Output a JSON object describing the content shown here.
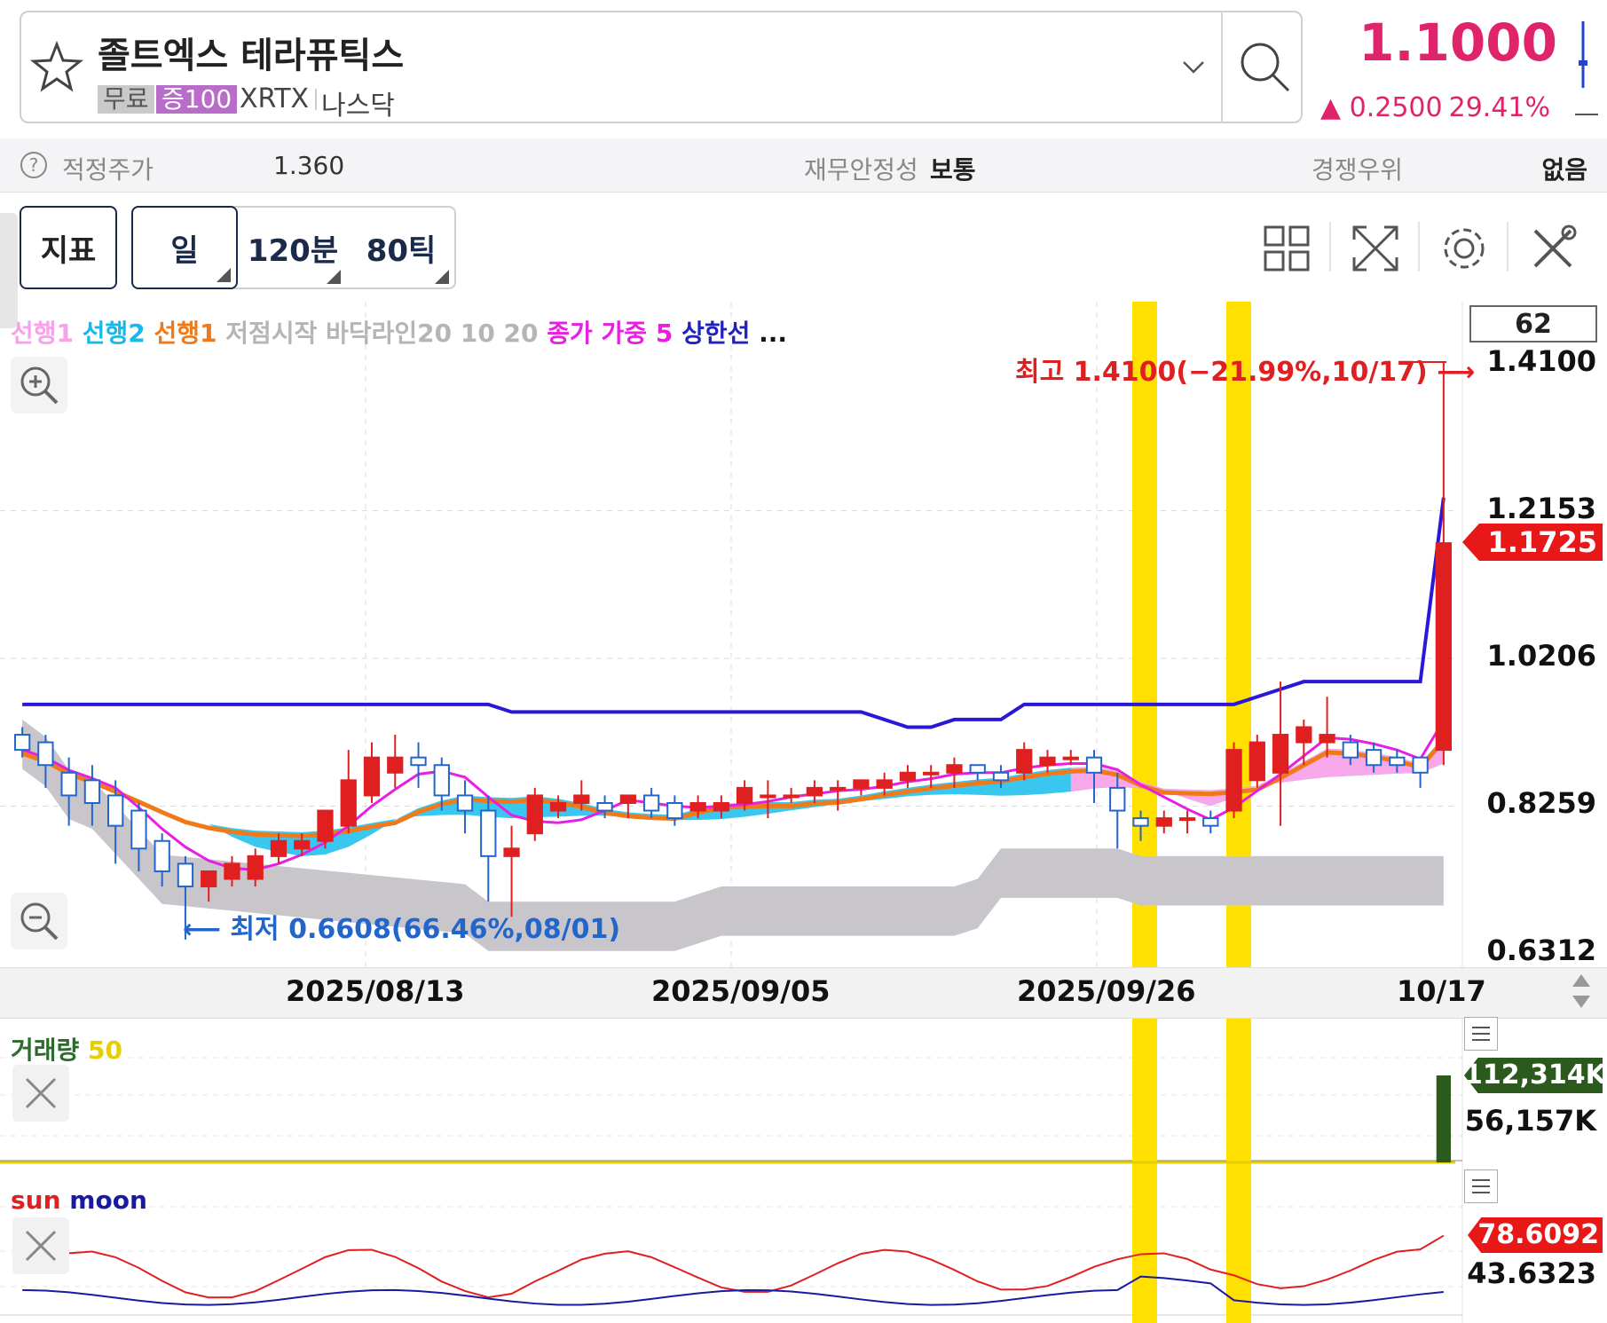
{
  "header": {
    "stock_name": "졸트엑스 테라퓨틱스",
    "tag_free": "무료",
    "tag_margin": "증100",
    "ticker": "XRTX",
    "exchange": "나스닥",
    "price": "1.1000",
    "change": "▲ 0.2500",
    "change_pct": "29.41%",
    "price_color": "#e0246b"
  },
  "info": {
    "fair_price_label": "적정주가",
    "fair_price_value": "1.360",
    "stability_label": "재무안정성",
    "stability_value": "보통",
    "competitive_label": "경쟁우위",
    "competitive_value": "없음"
  },
  "toolbar": {
    "indicator_label": "지표",
    "day_label": "일",
    "min120_label": "120분",
    "tick80_label": "80틱"
  },
  "legend": {
    "lead1": "선행1",
    "lead2": "선행2",
    "lead1b": "선행1",
    "extra": "저점시작 바닥라인20 10 20",
    "close_weight": "종가 가중 5",
    "upper": "상한선",
    "more": "..."
  },
  "chart_data": {
    "type": "candlestick",
    "visible_count": "62",
    "y_ticks": [
      "1.4100",
      "1.2153",
      "1.0206",
      "0.8259",
      "0.6312"
    ],
    "ylim": [
      0.6312,
      1.41
    ],
    "x_ticks": [
      "2025/08/13",
      "2025/09/05",
      "2025/09/26",
      "10/17"
    ],
    "current_price_tag": "1.1725",
    "high_annotation": "최고 1.4100(−21.99%,10/17) ⟶",
    "low_annotation": "⟵ 최저 0.6608(66.46%,08/01)",
    "candles": [
      {
        "o": 0.92,
        "h": 0.93,
        "l": 0.89,
        "c": 0.9
      },
      {
        "o": 0.91,
        "h": 0.92,
        "l": 0.85,
        "c": 0.88
      },
      {
        "o": 0.87,
        "h": 0.89,
        "l": 0.8,
        "c": 0.84
      },
      {
        "o": 0.86,
        "h": 0.88,
        "l": 0.8,
        "c": 0.83
      },
      {
        "o": 0.84,
        "h": 0.86,
        "l": 0.75,
        "c": 0.8
      },
      {
        "o": 0.82,
        "h": 0.83,
        "l": 0.74,
        "c": 0.77
      },
      {
        "o": 0.78,
        "h": 0.79,
        "l": 0.72,
        "c": 0.74
      },
      {
        "o": 0.75,
        "h": 0.76,
        "l": 0.65,
        "c": 0.72
      },
      {
        "o": 0.72,
        "h": 0.74,
        "l": 0.7,
        "c": 0.74
      },
      {
        "o": 0.73,
        "h": 0.76,
        "l": 0.72,
        "c": 0.75
      },
      {
        "o": 0.73,
        "h": 0.77,
        "l": 0.72,
        "c": 0.76
      },
      {
        "o": 0.76,
        "h": 0.79,
        "l": 0.75,
        "c": 0.78
      },
      {
        "o": 0.77,
        "h": 0.79,
        "l": 0.76,
        "c": 0.78
      },
      {
        "o": 0.78,
        "h": 0.82,
        "l": 0.77,
        "c": 0.82
      },
      {
        "o": 0.8,
        "h": 0.9,
        "l": 0.79,
        "c": 0.86
      },
      {
        "o": 0.84,
        "h": 0.91,
        "l": 0.83,
        "c": 0.89
      },
      {
        "o": 0.87,
        "h": 0.92,
        "l": 0.85,
        "c": 0.89
      },
      {
        "o": 0.89,
        "h": 0.91,
        "l": 0.85,
        "c": 0.88
      },
      {
        "o": 0.88,
        "h": 0.89,
        "l": 0.82,
        "c": 0.84
      },
      {
        "o": 0.84,
        "h": 0.86,
        "l": 0.79,
        "c": 0.82
      },
      {
        "o": 0.82,
        "h": 0.84,
        "l": 0.7,
        "c": 0.76
      },
      {
        "o": 0.76,
        "h": 0.8,
        "l": 0.68,
        "c": 0.77
      },
      {
        "o": 0.79,
        "h": 0.85,
        "l": 0.78,
        "c": 0.84
      },
      {
        "o": 0.82,
        "h": 0.84,
        "l": 0.81,
        "c": 0.83
      },
      {
        "o": 0.83,
        "h": 0.86,
        "l": 0.82,
        "c": 0.84
      },
      {
        "o": 0.83,
        "h": 0.84,
        "l": 0.81,
        "c": 0.82
      },
      {
        "o": 0.83,
        "h": 0.84,
        "l": 0.81,
        "c": 0.84
      },
      {
        "o": 0.84,
        "h": 0.85,
        "l": 0.81,
        "c": 0.82
      },
      {
        "o": 0.83,
        "h": 0.84,
        "l": 0.8,
        "c": 0.81
      },
      {
        "o": 0.82,
        "h": 0.84,
        "l": 0.81,
        "c": 0.83
      },
      {
        "o": 0.82,
        "h": 0.84,
        "l": 0.81,
        "c": 0.83
      },
      {
        "o": 0.83,
        "h": 0.86,
        "l": 0.82,
        "c": 0.85
      },
      {
        "o": 0.84,
        "h": 0.86,
        "l": 0.81,
        "c": 0.84
      },
      {
        "o": 0.84,
        "h": 0.85,
        "l": 0.83,
        "c": 0.84
      },
      {
        "o": 0.84,
        "h": 0.86,
        "l": 0.83,
        "c": 0.85
      },
      {
        "o": 0.85,
        "h": 0.86,
        "l": 0.82,
        "c": 0.85
      },
      {
        "o": 0.85,
        "h": 0.86,
        "l": 0.84,
        "c": 0.86
      },
      {
        "o": 0.85,
        "h": 0.87,
        "l": 0.84,
        "c": 0.86
      },
      {
        "o": 0.86,
        "h": 0.88,
        "l": 0.85,
        "c": 0.87
      },
      {
        "o": 0.87,
        "h": 0.88,
        "l": 0.85,
        "c": 0.87
      },
      {
        "o": 0.87,
        "h": 0.89,
        "l": 0.85,
        "c": 0.88
      },
      {
        "o": 0.88,
        "h": 0.88,
        "l": 0.86,
        "c": 0.87
      },
      {
        "o": 0.87,
        "h": 0.88,
        "l": 0.85,
        "c": 0.86
      },
      {
        "o": 0.87,
        "h": 0.91,
        "l": 0.86,
        "c": 0.9
      },
      {
        "o": 0.88,
        "h": 0.9,
        "l": 0.87,
        "c": 0.89
      },
      {
        "o": 0.89,
        "h": 0.9,
        "l": 0.88,
        "c": 0.89
      },
      {
        "o": 0.89,
        "h": 0.9,
        "l": 0.83,
        "c": 0.87
      },
      {
        "o": 0.85,
        "h": 0.87,
        "l": 0.77,
        "c": 0.82
      },
      {
        "o": 0.81,
        "h": 0.82,
        "l": 0.78,
        "c": 0.8
      },
      {
        "o": 0.8,
        "h": 0.82,
        "l": 0.79,
        "c": 0.81
      },
      {
        "o": 0.81,
        "h": 0.82,
        "l": 0.79,
        "c": 0.81
      },
      {
        "o": 0.81,
        "h": 0.82,
        "l": 0.79,
        "c": 0.8
      },
      {
        "o": 0.82,
        "h": 0.91,
        "l": 0.81,
        "c": 0.9
      },
      {
        "o": 0.86,
        "h": 0.92,
        "l": 0.85,
        "c": 0.91
      },
      {
        "o": 0.87,
        "h": 0.99,
        "l": 0.8,
        "c": 0.92
      },
      {
        "o": 0.91,
        "h": 0.94,
        "l": 0.88,
        "c": 0.93
      },
      {
        "o": 0.91,
        "h": 0.97,
        "l": 0.89,
        "c": 0.92
      },
      {
        "o": 0.91,
        "h": 0.92,
        "l": 0.88,
        "c": 0.89
      },
      {
        "o": 0.9,
        "h": 0.91,
        "l": 0.87,
        "c": 0.88
      },
      {
        "o": 0.89,
        "h": 0.9,
        "l": 0.87,
        "c": 0.88
      },
      {
        "o": 0.89,
        "h": 0.89,
        "l": 0.85,
        "c": 0.87
      },
      {
        "o": 0.9,
        "h": 1.41,
        "l": 0.88,
        "c": 1.1725
      }
    ],
    "volume": {
      "label": "거래량",
      "ma_label": "50",
      "max_tag": "112,314K",
      "mid_label": "56,157K"
    },
    "oscillator": {
      "sun_label": "sun",
      "moon_label": "moon",
      "sun_tag": "78.6092",
      "moon_value": "43.6323"
    }
  }
}
